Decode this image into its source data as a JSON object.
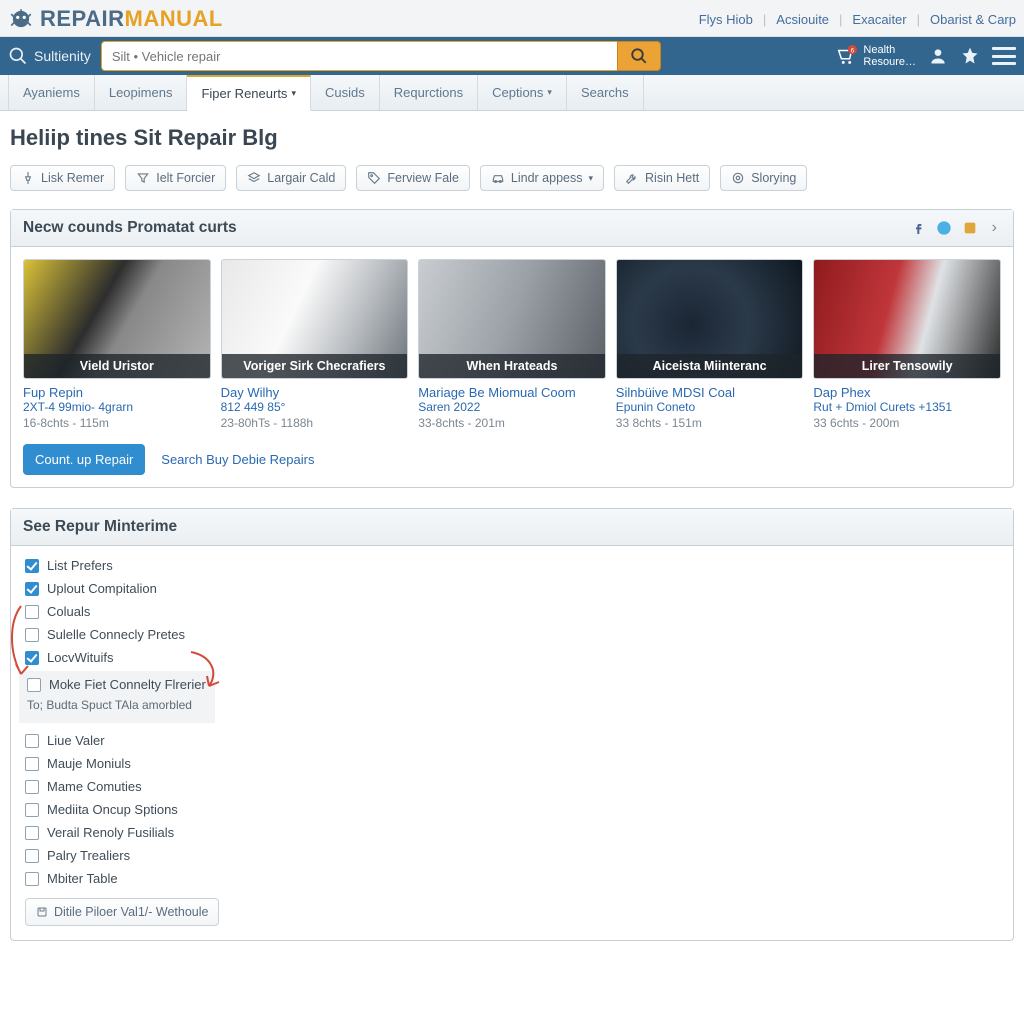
{
  "brand": {
    "w1": "REPAIR",
    "w2": "MANUAL"
  },
  "toplinks": [
    "Flys Hiob",
    "Acsiouite",
    "Exacaiter",
    "Obarist & Carp"
  ],
  "subidentity": "Sultienity",
  "search": {
    "placeholder": "Silt • Vehicle repair"
  },
  "health": {
    "line1": "Nealth",
    "line2": "Resoure…",
    "badge": "6"
  },
  "tabs": [
    {
      "label": "Ayaniems"
    },
    {
      "label": "Leopimens"
    },
    {
      "label": "Fiper Reneurts",
      "dropdown": true
    },
    {
      "label": "Cusids"
    },
    {
      "label": "Requrctions"
    },
    {
      "label": "Ceptions",
      "dropdown": true
    },
    {
      "label": "Searchs"
    }
  ],
  "active_tab_index": 2,
  "page_title": "Heliip tines Sit Repair Blg",
  "filters": [
    {
      "label": "Lisk Remer",
      "icon": "pin"
    },
    {
      "label": "Ielt Forcier",
      "icon": "filter"
    },
    {
      "label": "Largair Cald",
      "icon": "layers"
    },
    {
      "label": "Ferview Fale",
      "icon": "tag"
    },
    {
      "label": "Lindr appess",
      "icon": "car",
      "dropdown": true
    },
    {
      "label": "Risin Hett",
      "icon": "wrench"
    },
    {
      "label": "Slorying",
      "icon": "target"
    }
  ],
  "panel1": {
    "title": "Necw counds Promatat curts",
    "cards": [
      {
        "cap": "Vield Uristor",
        "t1": "Fup Repin",
        "t2": "2XT-4 99mio- 4grarn",
        "t3": "16-8chts - 115m"
      },
      {
        "cap": "Voriger Sirk Checrafiers",
        "t1": "Day Wilhy",
        "t2": "812 449 85°",
        "t3": "23-80hTs - 1188h"
      },
      {
        "cap": "When Hrateads",
        "t1": "Mariage Be Miomual Coom",
        "t2": "Saren 2022",
        "t3": "33-8chts - 201m"
      },
      {
        "cap": "Aiceista Miinteranc",
        "t1": "Silnbüive MDSI Coal",
        "t2": "Epunin Coneto",
        "t3": "33 8chts - 151m"
      },
      {
        "cap": "Lirer Tensowily",
        "t1": "Dap Phex",
        "t2": "Rut + Dmiol Curets +1351",
        "t3": "33 6chts - 200m"
      }
    ],
    "cta": "Count. up Repair",
    "cta_link": "Search Buy Debie Repairs"
  },
  "panel2": {
    "title": "See Repur Minterime",
    "items": [
      {
        "label": "List Prefers",
        "checked": true
      },
      {
        "label": "Uplout Compitalion",
        "checked": true
      },
      {
        "label": "Coluals",
        "checked": false
      },
      {
        "label": "Sulelle Connecly Pretes",
        "checked": false
      },
      {
        "label": "LocvWituifs",
        "checked": true
      },
      {
        "label": "Moke Fiet Connelty Flrerier",
        "checked": false,
        "tip": "To; Budta Spuct TAla amorbled"
      },
      {
        "label": "Liue Valer",
        "checked": false
      },
      {
        "label": "Mauje Moniuls",
        "checked": false
      },
      {
        "label": "Mame Comuties",
        "checked": false
      },
      {
        "label": "Mediita Oncup Sptions",
        "checked": false
      },
      {
        "label": "Verail Renoly Fusilials",
        "checked": false
      },
      {
        "label": "Palry Trealiers",
        "checked": false
      },
      {
        "label": "Mbiter Table",
        "checked": false
      }
    ],
    "bottom_btn": "Ditile Piloer Val1/- Wethoule"
  }
}
